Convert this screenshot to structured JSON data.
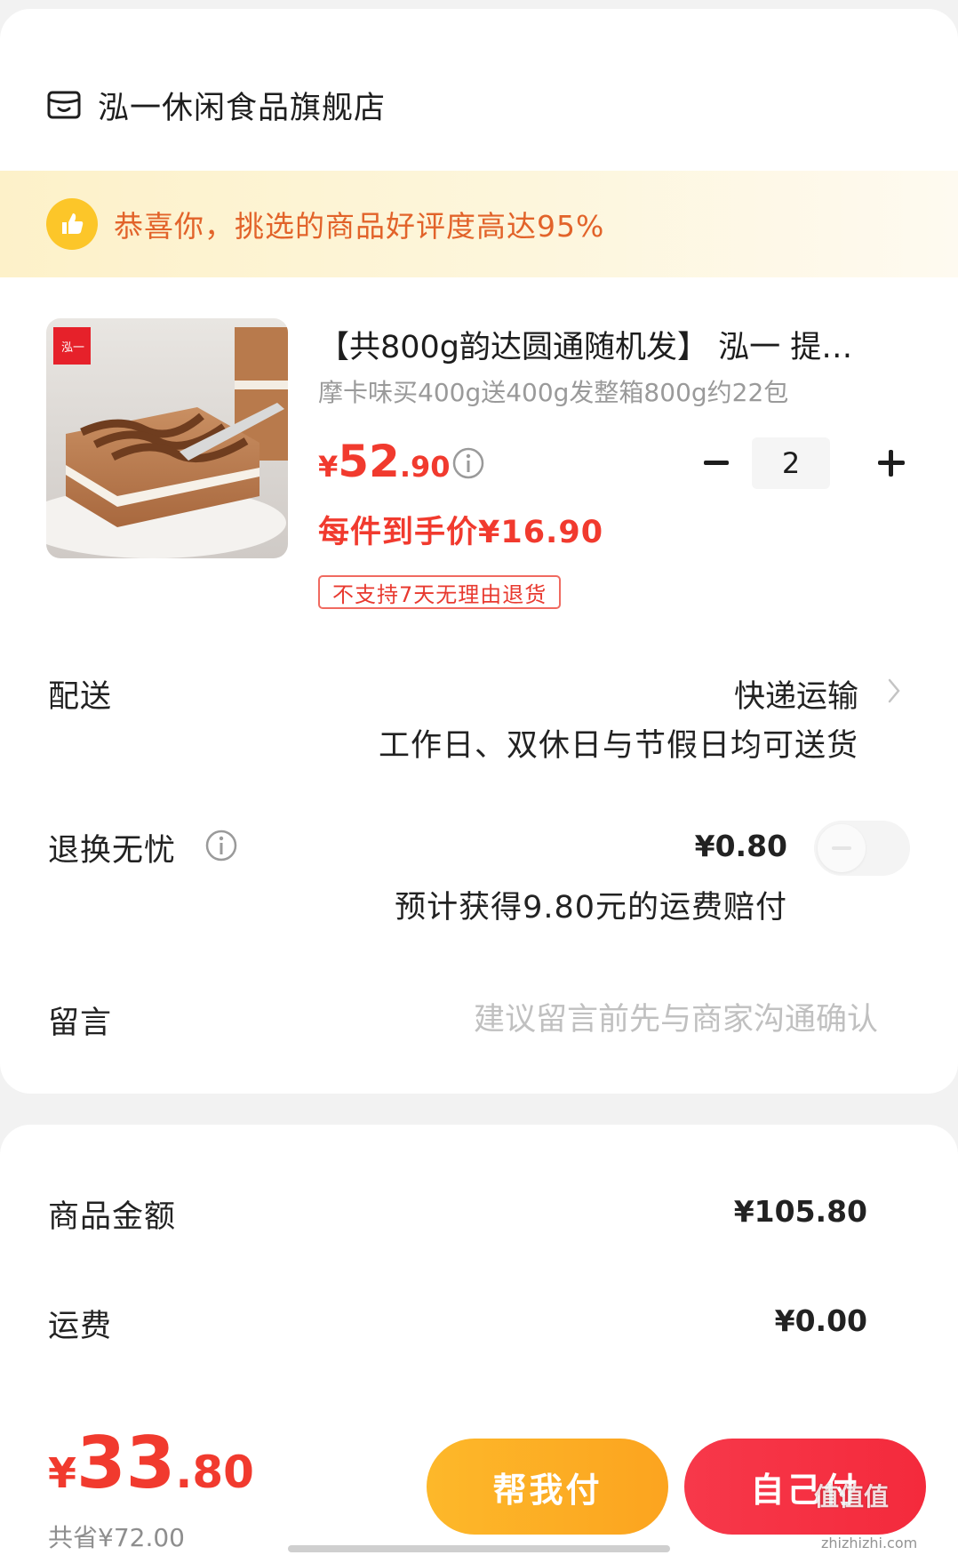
{
  "store": {
    "name": "泓一休闲食品旗舰店",
    "icon": "store-icon"
  },
  "banner": {
    "text": "恭喜你，挑选的商品好评度高达95%",
    "icon": "thumbs-up-icon"
  },
  "product": {
    "title": "【共800g韵达圆通随机发】 泓一 提…",
    "sku": "摩卡味买400g送400g发整箱800g约22包",
    "price": {
      "symbol": "¥",
      "integer": "52",
      "decimal": ".90"
    },
    "quantity": "2",
    "unit_price": "每件到手价¥16.90",
    "return_tag": "不支持7天无理由退货",
    "image_logo_text": "泓一"
  },
  "delivery": {
    "label": "配送",
    "value": "快递运输",
    "note": "工作日、双休日与节假日均可送货"
  },
  "return_insurance": {
    "label": "退换无忧",
    "price": "¥0.80",
    "note": "预计获得9.80元的运费赔付",
    "enabled": false
  },
  "message": {
    "label": "留言",
    "placeholder": "建议留言前先与商家沟通确认"
  },
  "summary": {
    "goods_label": "商品金额",
    "goods_amount": "¥105.80",
    "shipping_label": "运费",
    "shipping_amount": "¥0.00"
  },
  "checkout": {
    "total_symbol": "¥",
    "total_integer": "33",
    "total_decimal": ".80",
    "saved": "共省¥72.00",
    "help_pay_label": "帮我付",
    "self_pay_label": "自己付"
  },
  "watermark": {
    "text": "值值值",
    "site": "zhizhizhi.com"
  },
  "colors": {
    "accent": "#f13a2e",
    "banner_text": "#e2632a",
    "help_btn": "#fdb82a",
    "self_btn": "#f42a3c"
  }
}
